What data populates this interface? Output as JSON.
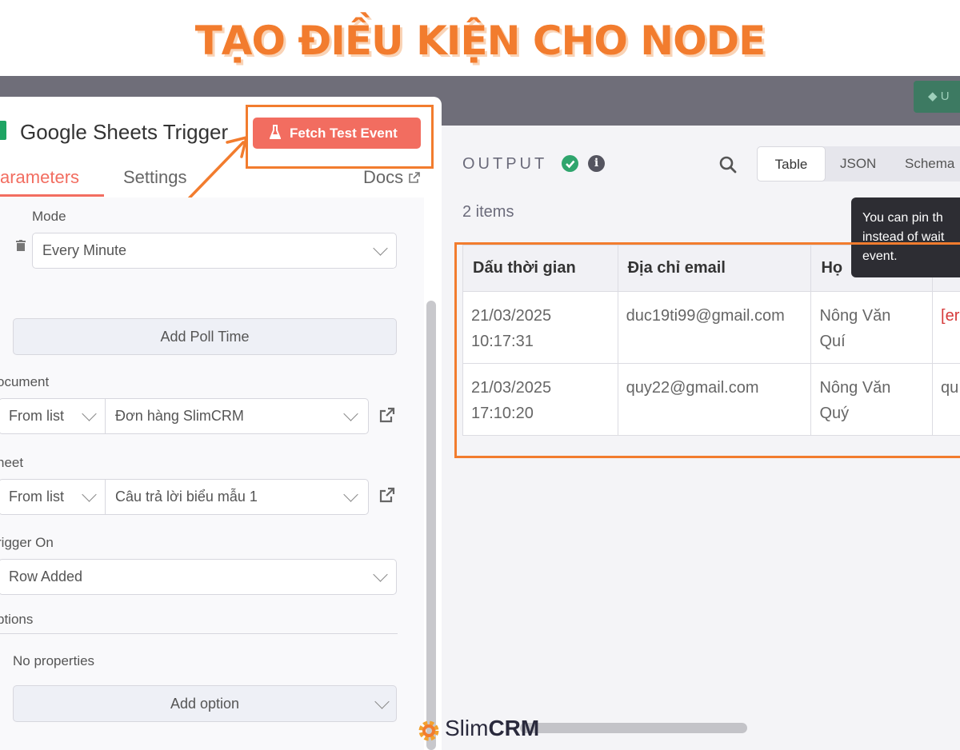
{
  "headline": "TẠO ĐIỀU KIỆN CHO NODE",
  "upgrade_label": "U",
  "node": {
    "title": "Google Sheets Trigger",
    "fetch_button": "Fetch Test Event",
    "tabs": {
      "parameters": "arameters",
      "settings": "Settings",
      "docs": "Docs"
    }
  },
  "params": {
    "mode_label": "Mode",
    "mode_value": "Every Minute",
    "add_poll_time": "Add Poll Time",
    "document_label": "ocument",
    "document_source": "From list",
    "document_value": "Đơn hàng SlimCRM",
    "sheet_label": "heet",
    "sheet_source": "From list",
    "sheet_value": "Câu trả lời biểu mẫu 1",
    "trigger_label": "rigger On",
    "trigger_value": "Row Added",
    "options_label": "ptions",
    "no_properties": "No properties",
    "add_option": "Add option"
  },
  "output": {
    "label": "OUTPUT",
    "view_tabs": [
      "Table",
      "JSON",
      "Schema"
    ],
    "active_tab": "Table",
    "items_count": "2 items",
    "tooltip_lines": [
      "You can pin th",
      "instead of wait",
      "event."
    ],
    "columns": [
      "Dấu thời gian",
      "Địa chỉ email",
      "Họ",
      ""
    ],
    "rows": [
      {
        "time": [
          "21/03/2025",
          "10:17:31"
        ],
        "email": "duc19ti99@gmail.com",
        "name": [
          "Nông Văn",
          "Quí"
        ],
        "extra": "[er"
      },
      {
        "time": [
          "21/03/2025",
          "17:10:20"
        ],
        "email": "quy22@gmail.com",
        "name": [
          "Nông Văn",
          "Quý"
        ],
        "extra": "qu"
      }
    ]
  },
  "logo": {
    "prefix": "Slim",
    "suffix": "CRM"
  },
  "colors": {
    "accent": "#f27c2e",
    "fetch": "#f26d60",
    "success": "#2fa56d"
  }
}
